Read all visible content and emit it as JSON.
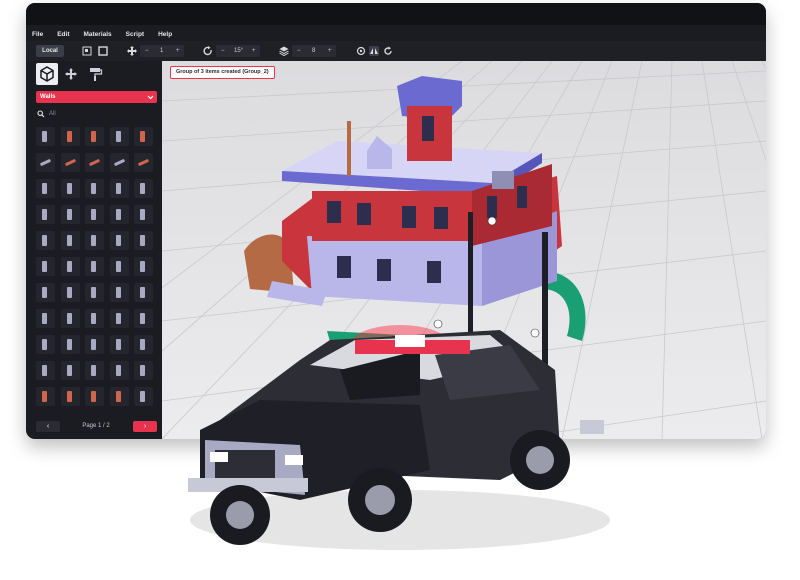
{
  "menu": [
    "File",
    "Edit",
    "Materials",
    "Script",
    "Help"
  ],
  "toolbar": {
    "local_label": "Local",
    "move_step": "1",
    "rotate_step": "15°",
    "layer_value": "8",
    "minus": "−",
    "plus": "+"
  },
  "sidebar": {
    "category": "Walls",
    "search_placeholder": "All",
    "page_label": "Page 1 / 2",
    "prev_glyph": "‹",
    "next_glyph": "›"
  },
  "viewport": {
    "toast": "Group of 3 items created (Group_2)"
  },
  "colors": {
    "accent": "#e8334f",
    "panel": "#1b1c21",
    "viewport_bg": "#e4e4e6",
    "house_red": "#c8353d",
    "roof_purple": "#6a6ad0",
    "trim_lavender": "#b9b6ea"
  },
  "icons": {
    "mode_tabs": [
      "cube-icon",
      "move-icon",
      "paint-roller-icon"
    ]
  }
}
